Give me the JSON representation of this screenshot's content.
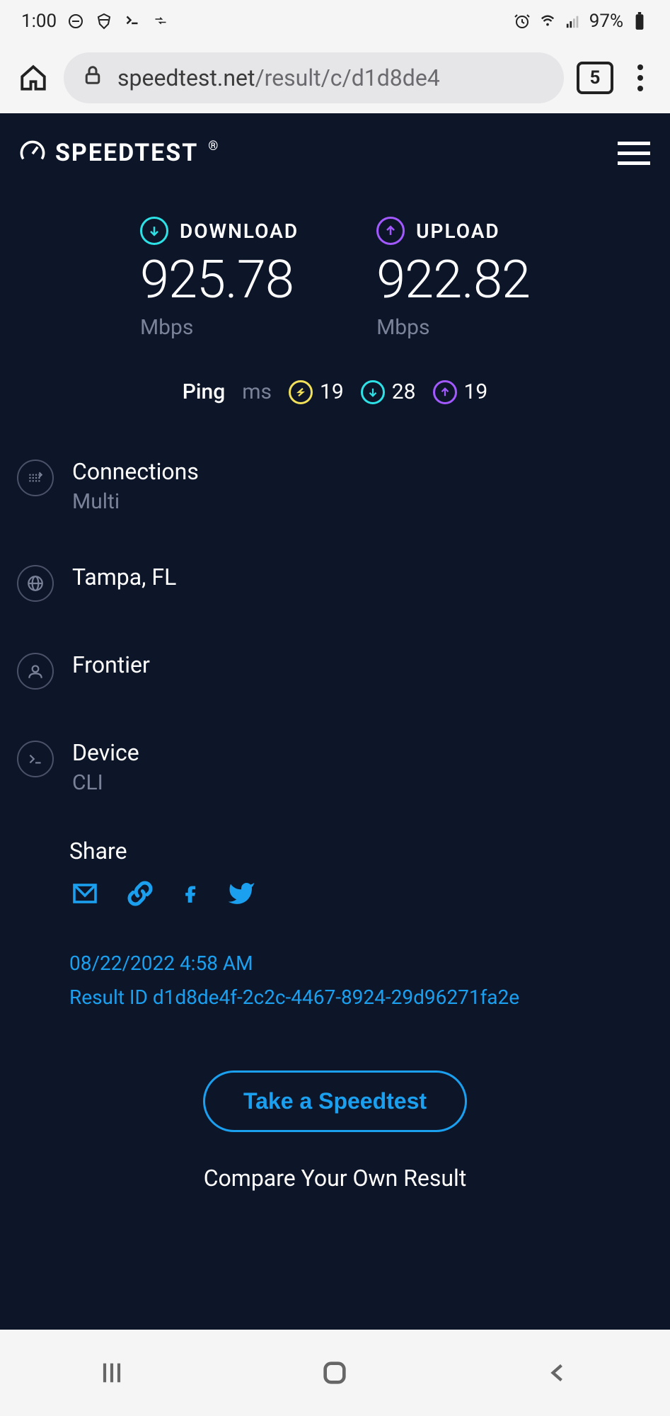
{
  "status": {
    "time": "1:00",
    "battery_pct": "97%"
  },
  "browser": {
    "url_host": "speedtest.net",
    "url_path": "/result/c/d1d8de4",
    "tab_count": "5"
  },
  "header": {
    "brand": "SPEEDTEST"
  },
  "speeds": {
    "download_label": "DOWNLOAD",
    "download_value": "925.78",
    "download_unit": "Mbps",
    "upload_label": "UPLOAD",
    "upload_value": "922.82",
    "upload_unit": "Mbps"
  },
  "ping": {
    "label": "Ping",
    "unit": "ms",
    "idle": "19",
    "download": "28",
    "upload": "19"
  },
  "info": {
    "connections_label": "Connections",
    "connections_value": "Multi",
    "location": "Tampa, FL",
    "isp": "Frontier",
    "device_label": "Device",
    "device_value": "CLI"
  },
  "share": {
    "label": "Share"
  },
  "meta": {
    "timestamp": "08/22/2022 4:58 AM",
    "result_id": "Result ID d1d8de4f-2c2c-4467-8924-29d96271fa2e"
  },
  "cta": {
    "button": "Take a Speedtest",
    "compare": "Compare Your Own Result"
  }
}
